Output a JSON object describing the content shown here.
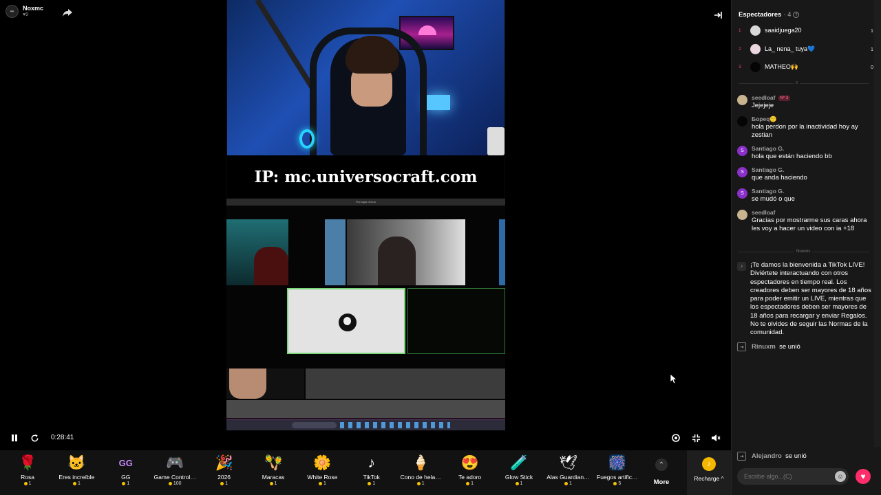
{
  "host": {
    "name": "Noxmc",
    "likes": "9"
  },
  "stream": {
    "ip_banner": "IP: mc.universocraft.com",
    "meeting_header": "Plomagia directo"
  },
  "player": {
    "time": "0:28:41"
  },
  "gifts": [
    {
      "label": "Rosa",
      "price": "1",
      "icon": "🌹"
    },
    {
      "label": "Eres increíble",
      "price": "1",
      "icon": "🐱"
    },
    {
      "label": "GG",
      "price": "1",
      "icon": "GG"
    },
    {
      "label": "Game Control…",
      "price": "100",
      "icon": "🎮"
    },
    {
      "label": "2026",
      "price": "1",
      "icon": "🎉"
    },
    {
      "label": "Maracas",
      "price": "1",
      "icon": "🪇"
    },
    {
      "label": "White Rose",
      "price": "1",
      "icon": "🌼"
    },
    {
      "label": "TikTok",
      "price": "1",
      "icon": "♪"
    },
    {
      "label": "Cono de hela…",
      "price": "1",
      "icon": "🍦"
    },
    {
      "label": "Te adoro",
      "price": "1",
      "icon": "😍"
    },
    {
      "label": "Glow Stick",
      "price": "1",
      "icon": "🧪"
    },
    {
      "label": "Alas Guardian…",
      "price": "1",
      "icon": "🕊"
    },
    {
      "label": "Fuegos artific…",
      "price": "5",
      "icon": "🎆"
    }
  ],
  "more_label": "More",
  "recharge_label": "Recharge ^",
  "panel": {
    "title": "Espectadores",
    "count": "· 4",
    "viewers": [
      {
        "rank": "1",
        "name": "saaidjuega20",
        "score": "1"
      },
      {
        "rank": "2",
        "name": "La_ nena_ tuya💙",
        "score": "1"
      },
      {
        "rank": "3",
        "name": "MATHEO🙌",
        "score": "0"
      }
    ],
    "sep_label": "0",
    "messages": [
      {
        "user": "seedloaf",
        "badge": "Nº 3",
        "text": "Jejejeje"
      },
      {
        "user": "Бореq🙂",
        "badge": "",
        "text": "hola perdon por la inactividad hoy ay zestian"
      },
      {
        "user": "Santiago G.",
        "badge": "",
        "text": "hola que están haciendo bb"
      },
      {
        "user": "Santiago G.",
        "badge": "",
        "text": "que anda haciendo"
      },
      {
        "user": "Santiago G.",
        "badge": "",
        "text": "se mudó o que"
      },
      {
        "user": "seedloaf",
        "badge": "",
        "text": "Gracias por mostrarme sus caras ahora les voy a hacer un video con ia +18"
      }
    ],
    "new_label": "Nuevos",
    "system_message": "¡Te damos la bienvenida a TikTok LIVE! Diviértete interactuando con otros espectadores en tiempo real. Los creadores deben ser mayores de 18 años para poder emitir un LIVE, mientras que los espectadores deben ser mayores de 18 años para recargar y enviar Regalos. No te olvides de seguir las Normas de la comunidad.",
    "joins": [
      {
        "user": "Rinuxm",
        "action": "se unió"
      },
      {
        "user": "Alejandro",
        "action": "se unió"
      }
    ],
    "input_placeholder": "Escribe algo...(C)"
  }
}
